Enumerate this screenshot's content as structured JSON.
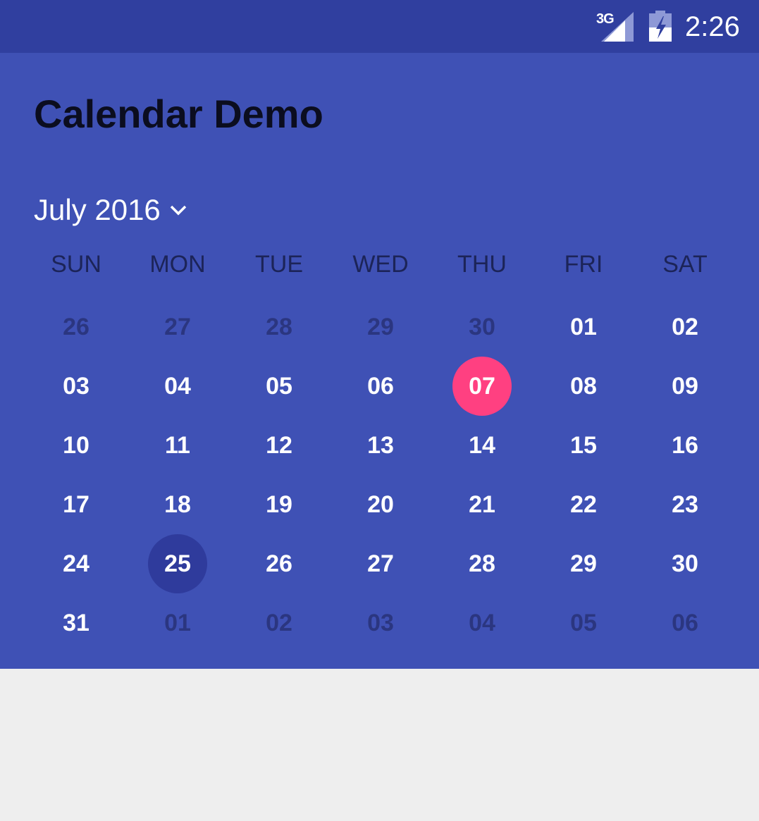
{
  "status_bar": {
    "network": "3G",
    "time": "2:26",
    "icons": [
      "signal-icon",
      "battery-charging-icon"
    ]
  },
  "app": {
    "title": "Calendar Demo"
  },
  "calendar": {
    "month_label": "July 2016",
    "weekdays": [
      "SUN",
      "MON",
      "TUE",
      "WED",
      "THU",
      "FRI",
      "SAT"
    ],
    "days": [
      {
        "label": "26",
        "state": "other"
      },
      {
        "label": "27",
        "state": "other"
      },
      {
        "label": "28",
        "state": "other"
      },
      {
        "label": "29",
        "state": "other"
      },
      {
        "label": "30",
        "state": "other"
      },
      {
        "label": "01",
        "state": "current"
      },
      {
        "label": "02",
        "state": "current"
      },
      {
        "label": "03",
        "state": "current"
      },
      {
        "label": "04",
        "state": "current"
      },
      {
        "label": "05",
        "state": "current"
      },
      {
        "label": "06",
        "state": "current"
      },
      {
        "label": "07",
        "state": "selected"
      },
      {
        "label": "08",
        "state": "current"
      },
      {
        "label": "09",
        "state": "current"
      },
      {
        "label": "10",
        "state": "current"
      },
      {
        "label": "11",
        "state": "current"
      },
      {
        "label": "12",
        "state": "current"
      },
      {
        "label": "13",
        "state": "current"
      },
      {
        "label": "14",
        "state": "current"
      },
      {
        "label": "15",
        "state": "current"
      },
      {
        "label": "16",
        "state": "current"
      },
      {
        "label": "17",
        "state": "current"
      },
      {
        "label": "18",
        "state": "current"
      },
      {
        "label": "19",
        "state": "current"
      },
      {
        "label": "20",
        "state": "current"
      },
      {
        "label": "21",
        "state": "current"
      },
      {
        "label": "22",
        "state": "current"
      },
      {
        "label": "23",
        "state": "current"
      },
      {
        "label": "24",
        "state": "current"
      },
      {
        "label": "25",
        "state": "today"
      },
      {
        "label": "26",
        "state": "current"
      },
      {
        "label": "27",
        "state": "current"
      },
      {
        "label": "28",
        "state": "current"
      },
      {
        "label": "29",
        "state": "current"
      },
      {
        "label": "30",
        "state": "current"
      },
      {
        "label": "31",
        "state": "current"
      },
      {
        "label": "01",
        "state": "other"
      },
      {
        "label": "02",
        "state": "other"
      },
      {
        "label": "03",
        "state": "other"
      },
      {
        "label": "04",
        "state": "other"
      },
      {
        "label": "05",
        "state": "other"
      },
      {
        "label": "06",
        "state": "other"
      }
    ]
  },
  "colors": {
    "status_bar": "#303f9f",
    "primary": "#3f51b5",
    "accent_selected": "#ff4081",
    "today_highlight": "#2f3b9c",
    "background": "#eeeeee"
  }
}
